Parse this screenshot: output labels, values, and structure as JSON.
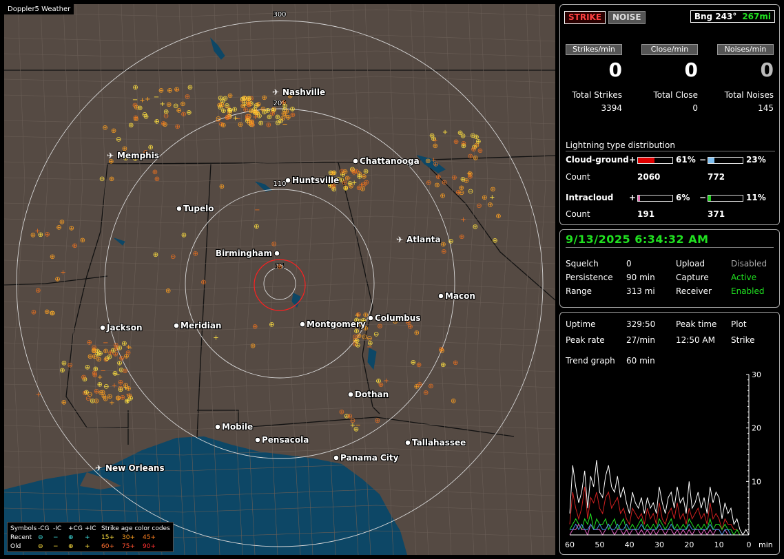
{
  "map": {
    "window_title": "Doppler5 Weather",
    "range_rings": [
      {
        "label": "15"
      },
      {
        "label": "110"
      },
      {
        "label": "205"
      },
      {
        "label": "300"
      }
    ],
    "cities": [
      {
        "name": "Nashville",
        "type": "airport"
      },
      {
        "name": "Memphis",
        "type": "airport"
      },
      {
        "name": "Chattanooga",
        "type": "city"
      },
      {
        "name": "Huntsville",
        "type": "city"
      },
      {
        "name": "Tupelo",
        "type": "city"
      },
      {
        "name": "Atlanta",
        "type": "airport"
      },
      {
        "name": "Birmingham",
        "type": "city"
      },
      {
        "name": "Macon",
        "type": "city"
      },
      {
        "name": "Jackson",
        "type": "city"
      },
      {
        "name": "Meridian",
        "type": "city"
      },
      {
        "name": "Montgomery",
        "type": "city"
      },
      {
        "name": "Columbus",
        "type": "city"
      },
      {
        "name": "Dothan",
        "type": "city"
      },
      {
        "name": "Mobile",
        "type": "city"
      },
      {
        "name": "Pensacola",
        "type": "city"
      },
      {
        "name": "Tallahassee",
        "type": "city"
      },
      {
        "name": "Panama City",
        "type": "city"
      },
      {
        "name": "New Orleans",
        "type": "airport"
      }
    ],
    "colors": {
      "land": "#554a43",
      "water": "#0d4766",
      "rings": "#d8d8d8",
      "center_ring": "#ff2020",
      "strike_recent": "#ffe040",
      "strike_mid": "#ffa020",
      "strike_old": "#e87020"
    },
    "legend": {
      "header": {
        "symbols": "Symbols",
        "neg_cg": "-CG",
        "neg_ic": "-IC",
        "pos_cg": "+CG",
        "pos_ic": "+IC",
        "age": "Strike age color codes"
      },
      "recent": {
        "label": "Recent",
        "c1": "15+",
        "c2": "30+",
        "c3": "45+"
      },
      "old": {
        "label": "Old",
        "c1": "60+",
        "c2": "75+",
        "c3": "90+"
      }
    }
  },
  "status": {
    "strike_btn": "STRIKE",
    "noise_btn": "NOISE",
    "bearing": "Bng 243°",
    "distance": "267mi",
    "rates": [
      {
        "label": "Strikes/min",
        "value": "0",
        "total_label": "Total Strikes",
        "total": "3394"
      },
      {
        "label": "Close/min",
        "value": "0",
        "total_label": "Total Close",
        "total": "0"
      },
      {
        "label": "Noises/min",
        "value": "0",
        "total_label": "Total Noises",
        "total": "145"
      }
    ],
    "distribution": {
      "title": "Lightning type distribution",
      "cg_label": "Cloud-ground",
      "ic_label": "Intracloud",
      "count_label": "Count",
      "plus": "+",
      "minus": "−",
      "cg_pos_pct": "61%",
      "cg_pos_frac": 0.61,
      "cg_neg_pct": "23%",
      "cg_neg_frac": 0.23,
      "cg_pos_count": "2060",
      "cg_neg_count": "772",
      "ic_pos_pct": "6%",
      "ic_pos_frac": 0.06,
      "ic_neg_pct": "11%",
      "ic_neg_frac": 0.11,
      "ic_pos_count": "191",
      "ic_neg_count": "371"
    }
  },
  "settings": {
    "datetime": "9/13/2025 6:34:32 AM",
    "squelch_label": "Squelch",
    "squelch": "0",
    "persistence_label": "Persistence",
    "persistence": "90 min",
    "range_label": "Range",
    "range": "313 mi",
    "upload_label": "Upload",
    "upload": "Disabled",
    "capture_label": "Capture",
    "capture": "Active",
    "receiver_label": "Receiver",
    "receiver": "Enabled"
  },
  "trend": {
    "uptime_label": "Uptime",
    "uptime": "329:50",
    "peak_time_label": "Peak time",
    "peak_time": "12:50 AM",
    "plot_label": "Plot",
    "plot": "Strike",
    "peak_rate_label": "Peak rate",
    "peak_rate": "27/min",
    "trend_graph_label": "Trend graph",
    "trend_graph": "60 min",
    "x_ticks": [
      "60",
      "50",
      "40",
      "30",
      "20",
      "10",
      "0"
    ],
    "x_unit": "min",
    "y_ticks": [
      "30",
      "20",
      "10"
    ]
  },
  "chart_data": {
    "type": "line",
    "xlabel": "min",
    "ylabel": "",
    "xlim": [
      60,
      0
    ],
    "ylim": [
      0,
      30
    ],
    "x": [
      60,
      59,
      58,
      57,
      56,
      55,
      54,
      53,
      52,
      51,
      50,
      49,
      48,
      47,
      46,
      45,
      44,
      43,
      42,
      41,
      40,
      39,
      38,
      37,
      36,
      35,
      34,
      33,
      32,
      31,
      30,
      29,
      28,
      27,
      26,
      25,
      24,
      23,
      22,
      21,
      20,
      19,
      18,
      17,
      16,
      15,
      14,
      13,
      12,
      11,
      10,
      9,
      8,
      7,
      6,
      5,
      4,
      3,
      2,
      1,
      0
    ],
    "series": [
      {
        "color": "#ffffff",
        "values": [
          4,
          13,
          9,
          6,
          8,
          12,
          5,
          11,
          9,
          14,
          8,
          7,
          11,
          13,
          9,
          8,
          11,
          7,
          9,
          6,
          4,
          8,
          6,
          5,
          7,
          4,
          7,
          5,
          6,
          4,
          9,
          6,
          4,
          7,
          8,
          5,
          9,
          6,
          7,
          4,
          10,
          5,
          6,
          8,
          5,
          7,
          4,
          9,
          6,
          8,
          7,
          3,
          6,
          4,
          5,
          2,
          3,
          1,
          0,
          1,
          0
        ]
      },
      {
        "color": "#d02020",
        "values": [
          2,
          8,
          5,
          3,
          5,
          9,
          3,
          7,
          6,
          8,
          5,
          4,
          7,
          8,
          5,
          6,
          7,
          4,
          5,
          3,
          2,
          5,
          4,
          3,
          4,
          2,
          5,
          3,
          4,
          2,
          6,
          3,
          2,
          4,
          5,
          3,
          6,
          3,
          4,
          2,
          5,
          3,
          4,
          5,
          3,
          4,
          2,
          6,
          3,
          4,
          3,
          1,
          3,
          2,
          2,
          1,
          1,
          0,
          0,
          0,
          0
        ]
      },
      {
        "color": "#20e020",
        "values": [
          1,
          2,
          3,
          2,
          1,
          3,
          2,
          4,
          1,
          3,
          2,
          2,
          3,
          1,
          2,
          3,
          1,
          2,
          3,
          1,
          1,
          2,
          1,
          2,
          3,
          1,
          2,
          1,
          2,
          1,
          3,
          2,
          1,
          2,
          3,
          1,
          2,
          1,
          2,
          1,
          3,
          2,
          1,
          2,
          1,
          2,
          1,
          3,
          1,
          2,
          2,
          1,
          2,
          1,
          1,
          0,
          1,
          0,
          0,
          0,
          0
        ]
      },
      {
        "color": "#e060c0",
        "values": [
          0,
          1,
          1,
          2,
          1,
          1,
          0,
          2,
          1,
          1,
          1,
          0,
          1,
          2,
          1,
          0,
          1,
          1,
          0,
          1,
          0,
          1,
          1,
          0,
          1,
          0,
          1,
          0,
          1,
          0,
          1,
          1,
          0,
          1,
          1,
          0,
          1,
          0,
          1,
          0,
          1,
          0,
          1,
          1,
          0,
          1,
          0,
          1,
          0,
          1,
          1,
          0,
          1,
          0,
          0,
          0,
          0,
          0,
          0,
          0,
          0
        ]
      },
      {
        "color": "#4090e0",
        "values": [
          1,
          1,
          2,
          1,
          2,
          1,
          1,
          2,
          1,
          1,
          2,
          1,
          1,
          2,
          1,
          1,
          2,
          1,
          1,
          2,
          1,
          1,
          1,
          1,
          2,
          1,
          1,
          1,
          1,
          1,
          2,
          1,
          1,
          1,
          2,
          1,
          1,
          1,
          1,
          1,
          2,
          1,
          1,
          1,
          1,
          1,
          1,
          2,
          1,
          1,
          1,
          0,
          1,
          1,
          0,
          0,
          0,
          0,
          0,
          0,
          0
        ]
      }
    ]
  }
}
